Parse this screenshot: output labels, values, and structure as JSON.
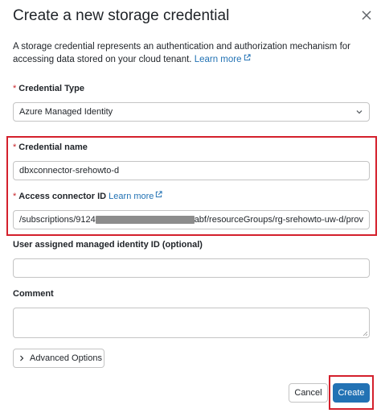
{
  "dialog": {
    "title": "Create a new storage credential",
    "description": "A storage credential represents an authentication and authorization mechanism for accessing data stored on your cloud tenant.",
    "learn_more": "Learn more"
  },
  "credential_type": {
    "label": "Credential Type",
    "value": "Azure Managed Identity"
  },
  "credential_name": {
    "label": "Credential name",
    "value": "dbxconnector-srehowto-d"
  },
  "access_connector": {
    "label": "Access connector ID",
    "learn_more": "Learn more",
    "value_start": "/subscriptions/9124",
    "value_end": "abf/resourceGroups/rg-srehowto-uw-d/prov"
  },
  "user_identity": {
    "label": "User assigned managed identity ID (optional)",
    "value": ""
  },
  "comment": {
    "label": "Comment",
    "value": ""
  },
  "buttons": {
    "advanced": "Advanced Options",
    "cancel": "Cancel",
    "create": "Create"
  },
  "required_marker": "*",
  "colors": {
    "accent": "#2272b4",
    "highlight": "#d4202c",
    "required": "#c8242a"
  },
  "icons": [
    "close-icon",
    "external-link-icon",
    "chevron-down-icon",
    "chevron-right-icon"
  ]
}
